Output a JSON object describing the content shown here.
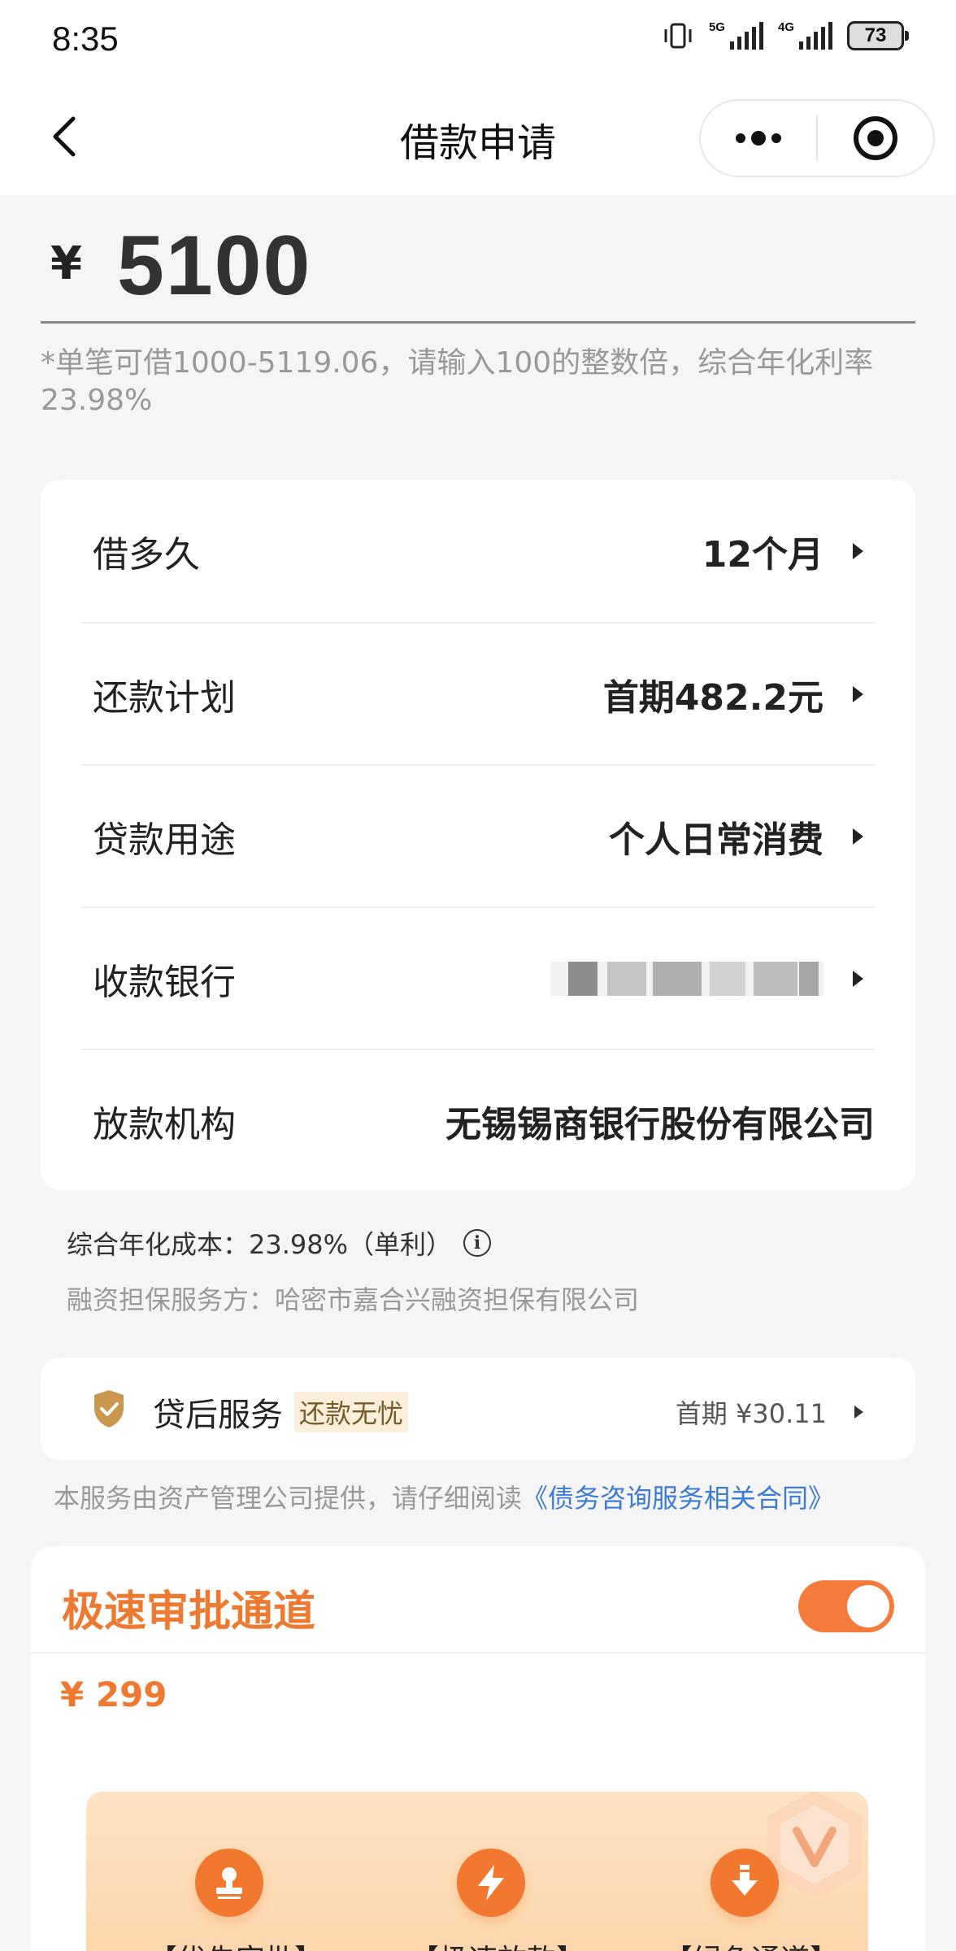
{
  "status_bar": {
    "time": "8:35",
    "net1": "5G",
    "net2": "4G",
    "battery": "73"
  },
  "nav": {
    "title": "借款申请"
  },
  "amount": {
    "currency": "¥",
    "value": "5100"
  },
  "hint": "*单笔可借1000-5119.06，请输入100的整数倍，综合年化利率23.98%",
  "loan_rows": [
    {
      "label": "借多久",
      "value": "12个月"
    },
    {
      "label": "还款计划",
      "value": "首期482.2元"
    },
    {
      "label": "贷款用途",
      "value": "个人日常消费"
    },
    {
      "label": "收款银行",
      "value": ""
    },
    {
      "label": "放款机构",
      "value": "无锡锡商银行股份有限公司"
    }
  ],
  "cost": {
    "text": "综合年化成本：23.98%（单利）",
    "info_icon": "info-icon"
  },
  "guarantor": "融资担保服务方：哈密市嘉合兴融资担保有限公司",
  "after_service": {
    "title": "贷后服务",
    "tag": "还款无忧",
    "price": "首期 ¥30.11"
  },
  "notice": {
    "text": "本服务由资产管理公司提供，请仔细阅读",
    "link": "《债务咨询服务相关合同》"
  },
  "fast_approval": {
    "title": "极速审批通道",
    "toggle_on": true,
    "price": "¥ 299",
    "features": [
      {
        "icon": "stamp-icon",
        "label": "【优先审批】"
      },
      {
        "icon": "lightning-icon",
        "label": "【极速放款】"
      },
      {
        "icon": "download-icon",
        "label": "【绿色通道】"
      }
    ]
  },
  "colors": {
    "accent": "#f47b3c",
    "link": "#3a7bd5",
    "badge": "#c9974e"
  }
}
